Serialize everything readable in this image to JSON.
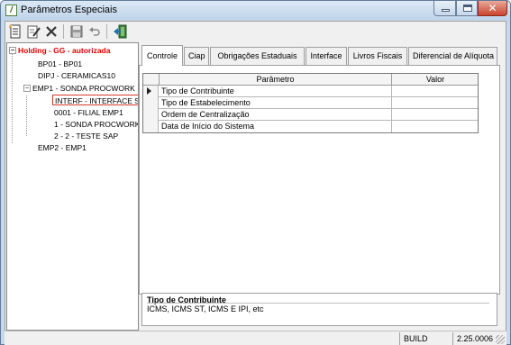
{
  "window": {
    "title": "Parâmetros Especiais",
    "app_icon_glyph": "/",
    "close_glyph": "✕"
  },
  "toolbar": {
    "buttons": [
      "new-document-icon",
      "edit-icon",
      "delete-icon",
      "save-icon",
      "undo-icon",
      "exit-icon"
    ]
  },
  "tree": {
    "root_label": "Holding -  GG -  autorizada",
    "items": [
      {
        "label": "BP01 - BP01"
      },
      {
        "label": "DIPJ - CERAMICAS10"
      },
      {
        "label": "EMP1 - SONDA PROCWORK"
      },
      {
        "label": "INTERF - INTERFACE SAP"
      },
      {
        "label": "0001 - FILIAL EMP1"
      },
      {
        "label": "1 - SONDA PROCWORK"
      },
      {
        "label": "2 - 2 - TESTE SAP"
      },
      {
        "label": "EMP2 - EMP1"
      }
    ],
    "expander_minus": "−",
    "scroll_left": "◂",
    "scroll_right": "▸"
  },
  "tabs": [
    {
      "label": "Controle",
      "active": true
    },
    {
      "label": "Ciap"
    },
    {
      "label": "Obrigações Estaduais"
    },
    {
      "label": "Interface"
    },
    {
      "label": "Livros Fiscais"
    },
    {
      "label": "Diferencial de Alíquota"
    }
  ],
  "grid": {
    "headers": {
      "param": "Parâmetro",
      "value": "Valor"
    },
    "rows": [
      {
        "param": "Tipo de Contribuinte",
        "value": ""
      },
      {
        "param": "Tipo de Estabelecimento",
        "value": ""
      },
      {
        "param": "Ordem de Centralização",
        "value": ""
      },
      {
        "param": "Data de Início do Sistema",
        "value": ""
      }
    ]
  },
  "description": {
    "title": "Tipo de Contribuinte",
    "text": "ICMS, ICMS ST, ICMS E IPI, etc"
  },
  "status": {
    "build_label": "BUILD",
    "build_value": "2.25.0006"
  }
}
